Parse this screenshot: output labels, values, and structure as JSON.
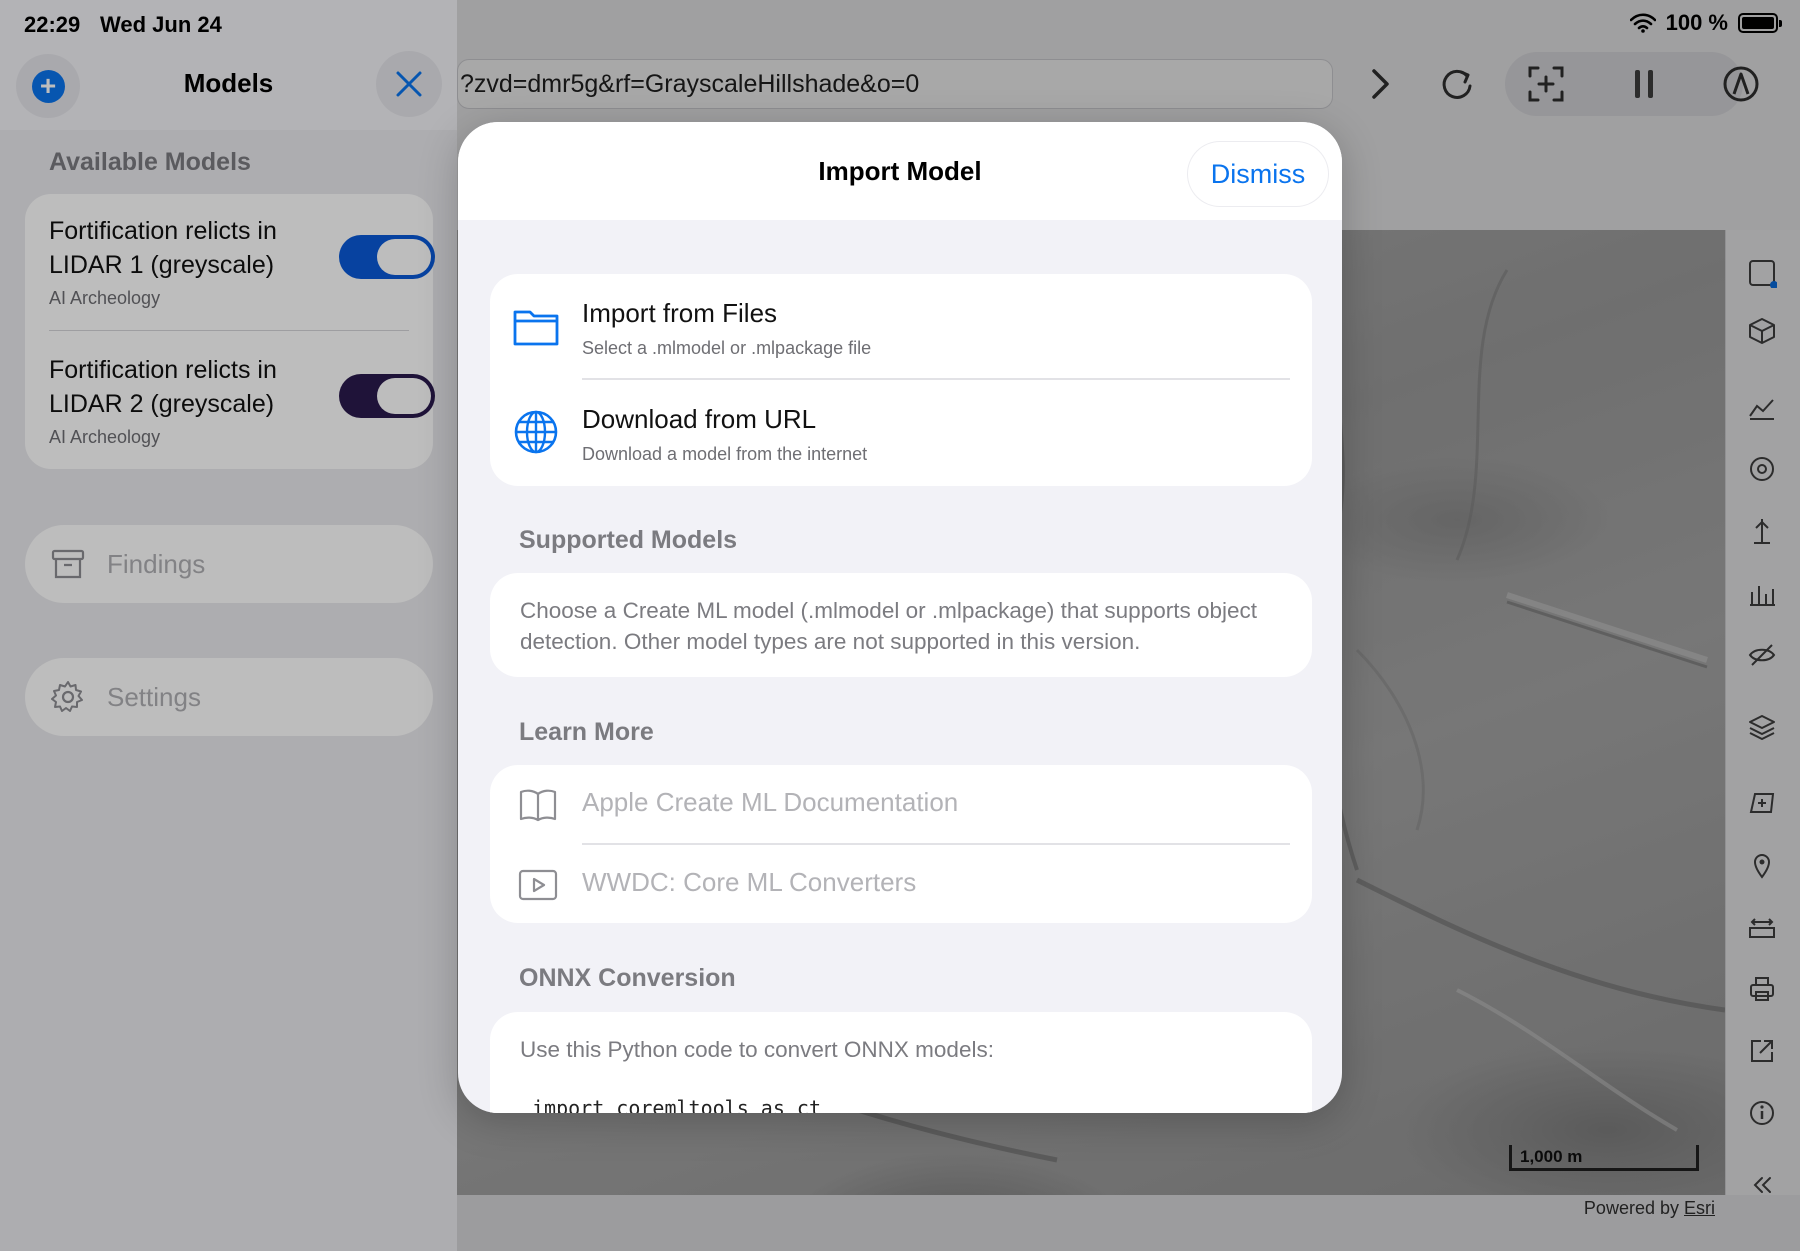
{
  "status_bar": {
    "time": "22:29",
    "date": "Wed Jun 24",
    "battery": "100 %"
  },
  "browser": {
    "url": "?zvd=dmr5g&rf=GrayscaleHillshade&o=0",
    "scale_label": "1,000 m",
    "attribution_prefix": "Powered by",
    "attribution_link": "Esri"
  },
  "sidebar": {
    "title": "Models",
    "section_label": "Available Models",
    "models": [
      {
        "name": "Fortification relicts in LIDAR 1 (greyscale)",
        "source": "AI Archeology",
        "enabled": true,
        "toggle_color": "#0a5ad8"
      },
      {
        "name": "Fortification relicts in LIDAR 2 (greyscale)",
        "source": "AI Archeology",
        "enabled": true,
        "toggle_color": "#2b1a4d"
      }
    ],
    "nav": [
      {
        "label": "Findings",
        "icon": "archive-box-icon"
      },
      {
        "label": "Settings",
        "icon": "gear-icon"
      }
    ]
  },
  "modal": {
    "title": "Import Model",
    "dismiss_label": "Dismiss",
    "actions": [
      {
        "title": "Import from Files",
        "subtitle": "Select a .mlmodel or .mlpackage file",
        "icon": "folder-icon"
      },
      {
        "title": "Download from URL",
        "subtitle": "Download a model from the internet",
        "icon": "globe-icon"
      }
    ],
    "supported": {
      "label": "Supported Models",
      "text": "Choose a Create ML model (.mlmodel or .mlpackage) that supports object detection. Other model types are not supported in this version."
    },
    "learn_more": {
      "label": "Learn More",
      "links": [
        {
          "label": "Apple Create ML Documentation",
          "icon": "book-icon"
        },
        {
          "label": "WWDC: Core ML Converters",
          "icon": "play-icon"
        }
      ]
    },
    "onnx": {
      "label": "ONNX Conversion",
      "text": "Use this Python code to convert ONNX models:",
      "code": "import coremltools as ct"
    }
  },
  "colors": {
    "accent": "#0a74ee"
  }
}
